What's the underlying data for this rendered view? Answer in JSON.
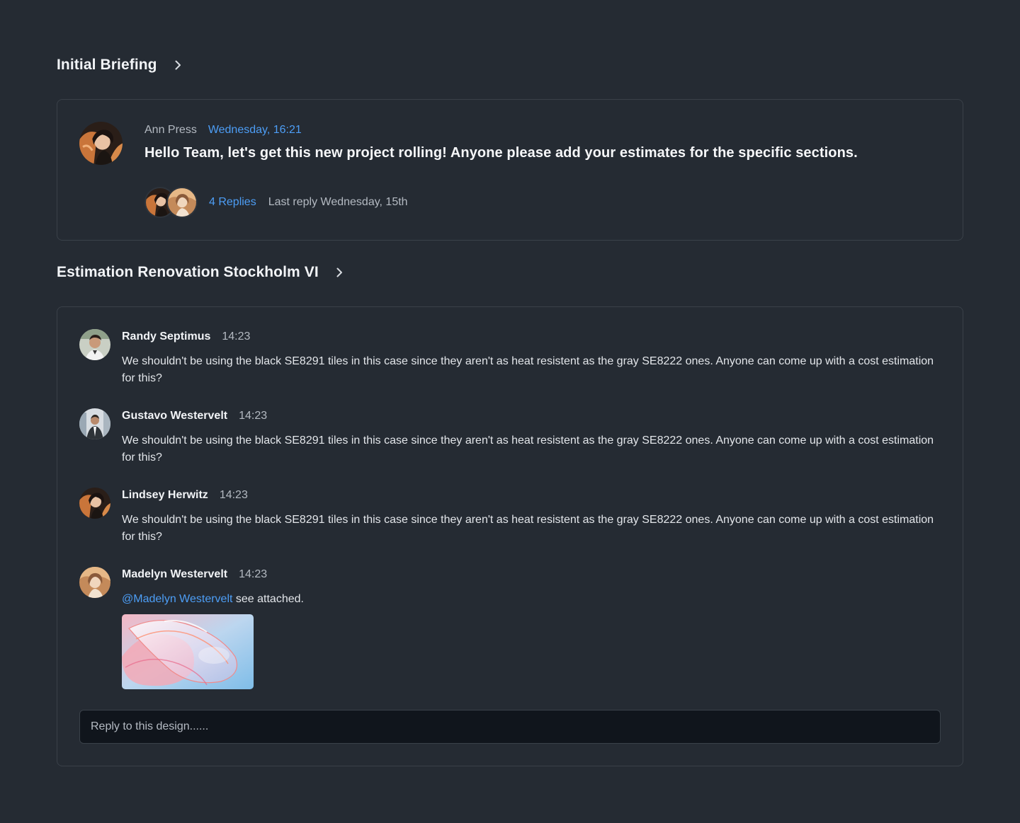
{
  "threads": [
    {
      "title": "Initial Briefing",
      "post": {
        "author": "Ann Press",
        "time": "Wednesday, 16:21",
        "message": "Hello Team, let's get this new project rolling! Anyone please add your estimates for the specific sections.",
        "replies_label": "4 Replies",
        "last_reply": "Last reply Wednesday, 15th"
      }
    },
    {
      "title": "Estimation Renovation Stockholm VI",
      "comments": [
        {
          "name": "Randy Septimus",
          "time": "14:23",
          "text": "We shouldn't be using the black SE8291 tiles in this case since they aren't as heat resistent as the gray SE8222 ones. Anyone can come up with a cost estimation for this?"
        },
        {
          "name": "Gustavo Westervelt",
          "time": "14:23",
          "text": "We shouldn't be using the black SE8291 tiles in this case since they aren't as heat resistent as the gray SE8222 ones. Anyone can come up with a cost estimation for this?"
        },
        {
          "name": "Lindsey Herwitz",
          "time": "14:23",
          "text": "We shouldn't be using the black SE8291 tiles in this case since they aren't as heat resistent as the gray SE8222 ones. Anyone can come up with a cost estimation for this?"
        },
        {
          "name": "Madelyn Westervelt",
          "time": "14:23",
          "mention": "@Madelyn Westervelt",
          "text": " see attached."
        }
      ],
      "reply_placeholder": "Reply to this design......"
    }
  ],
  "colors": {
    "background": "#252b33",
    "accent": "#4d9ef6",
    "border": "#3a4149",
    "input_bg": "#10151c"
  },
  "icons": {
    "section_toggle": "chevron-right-icon"
  }
}
